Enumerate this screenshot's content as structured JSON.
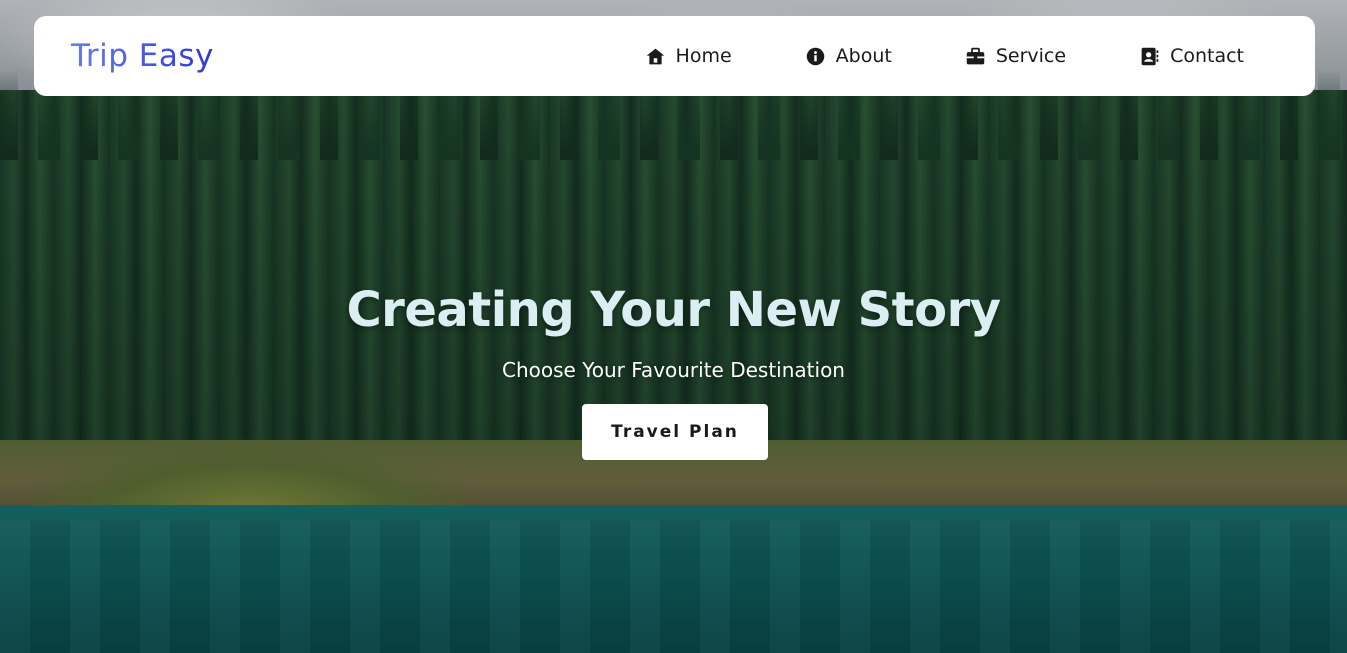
{
  "brand": {
    "name": "Trip Easy"
  },
  "nav": {
    "items": [
      {
        "label": "Home",
        "icon": "home-icon"
      },
      {
        "label": "About",
        "icon": "info-icon"
      },
      {
        "label": "Service",
        "icon": "briefcase-icon"
      },
      {
        "label": "Contact",
        "icon": "contact-card-icon"
      }
    ]
  },
  "hero": {
    "title": "Creating Your New Story",
    "subtitle": "Choose Your Favourite Destination",
    "cta_label": "Travel Plan"
  },
  "colors": {
    "logo_gradient_start": "#6a7de8",
    "logo_gradient_end": "#2d36d6",
    "hero_title": "#dbeef2",
    "nav_text": "#1b1b1b",
    "navbar_bg": "#ffffff"
  }
}
